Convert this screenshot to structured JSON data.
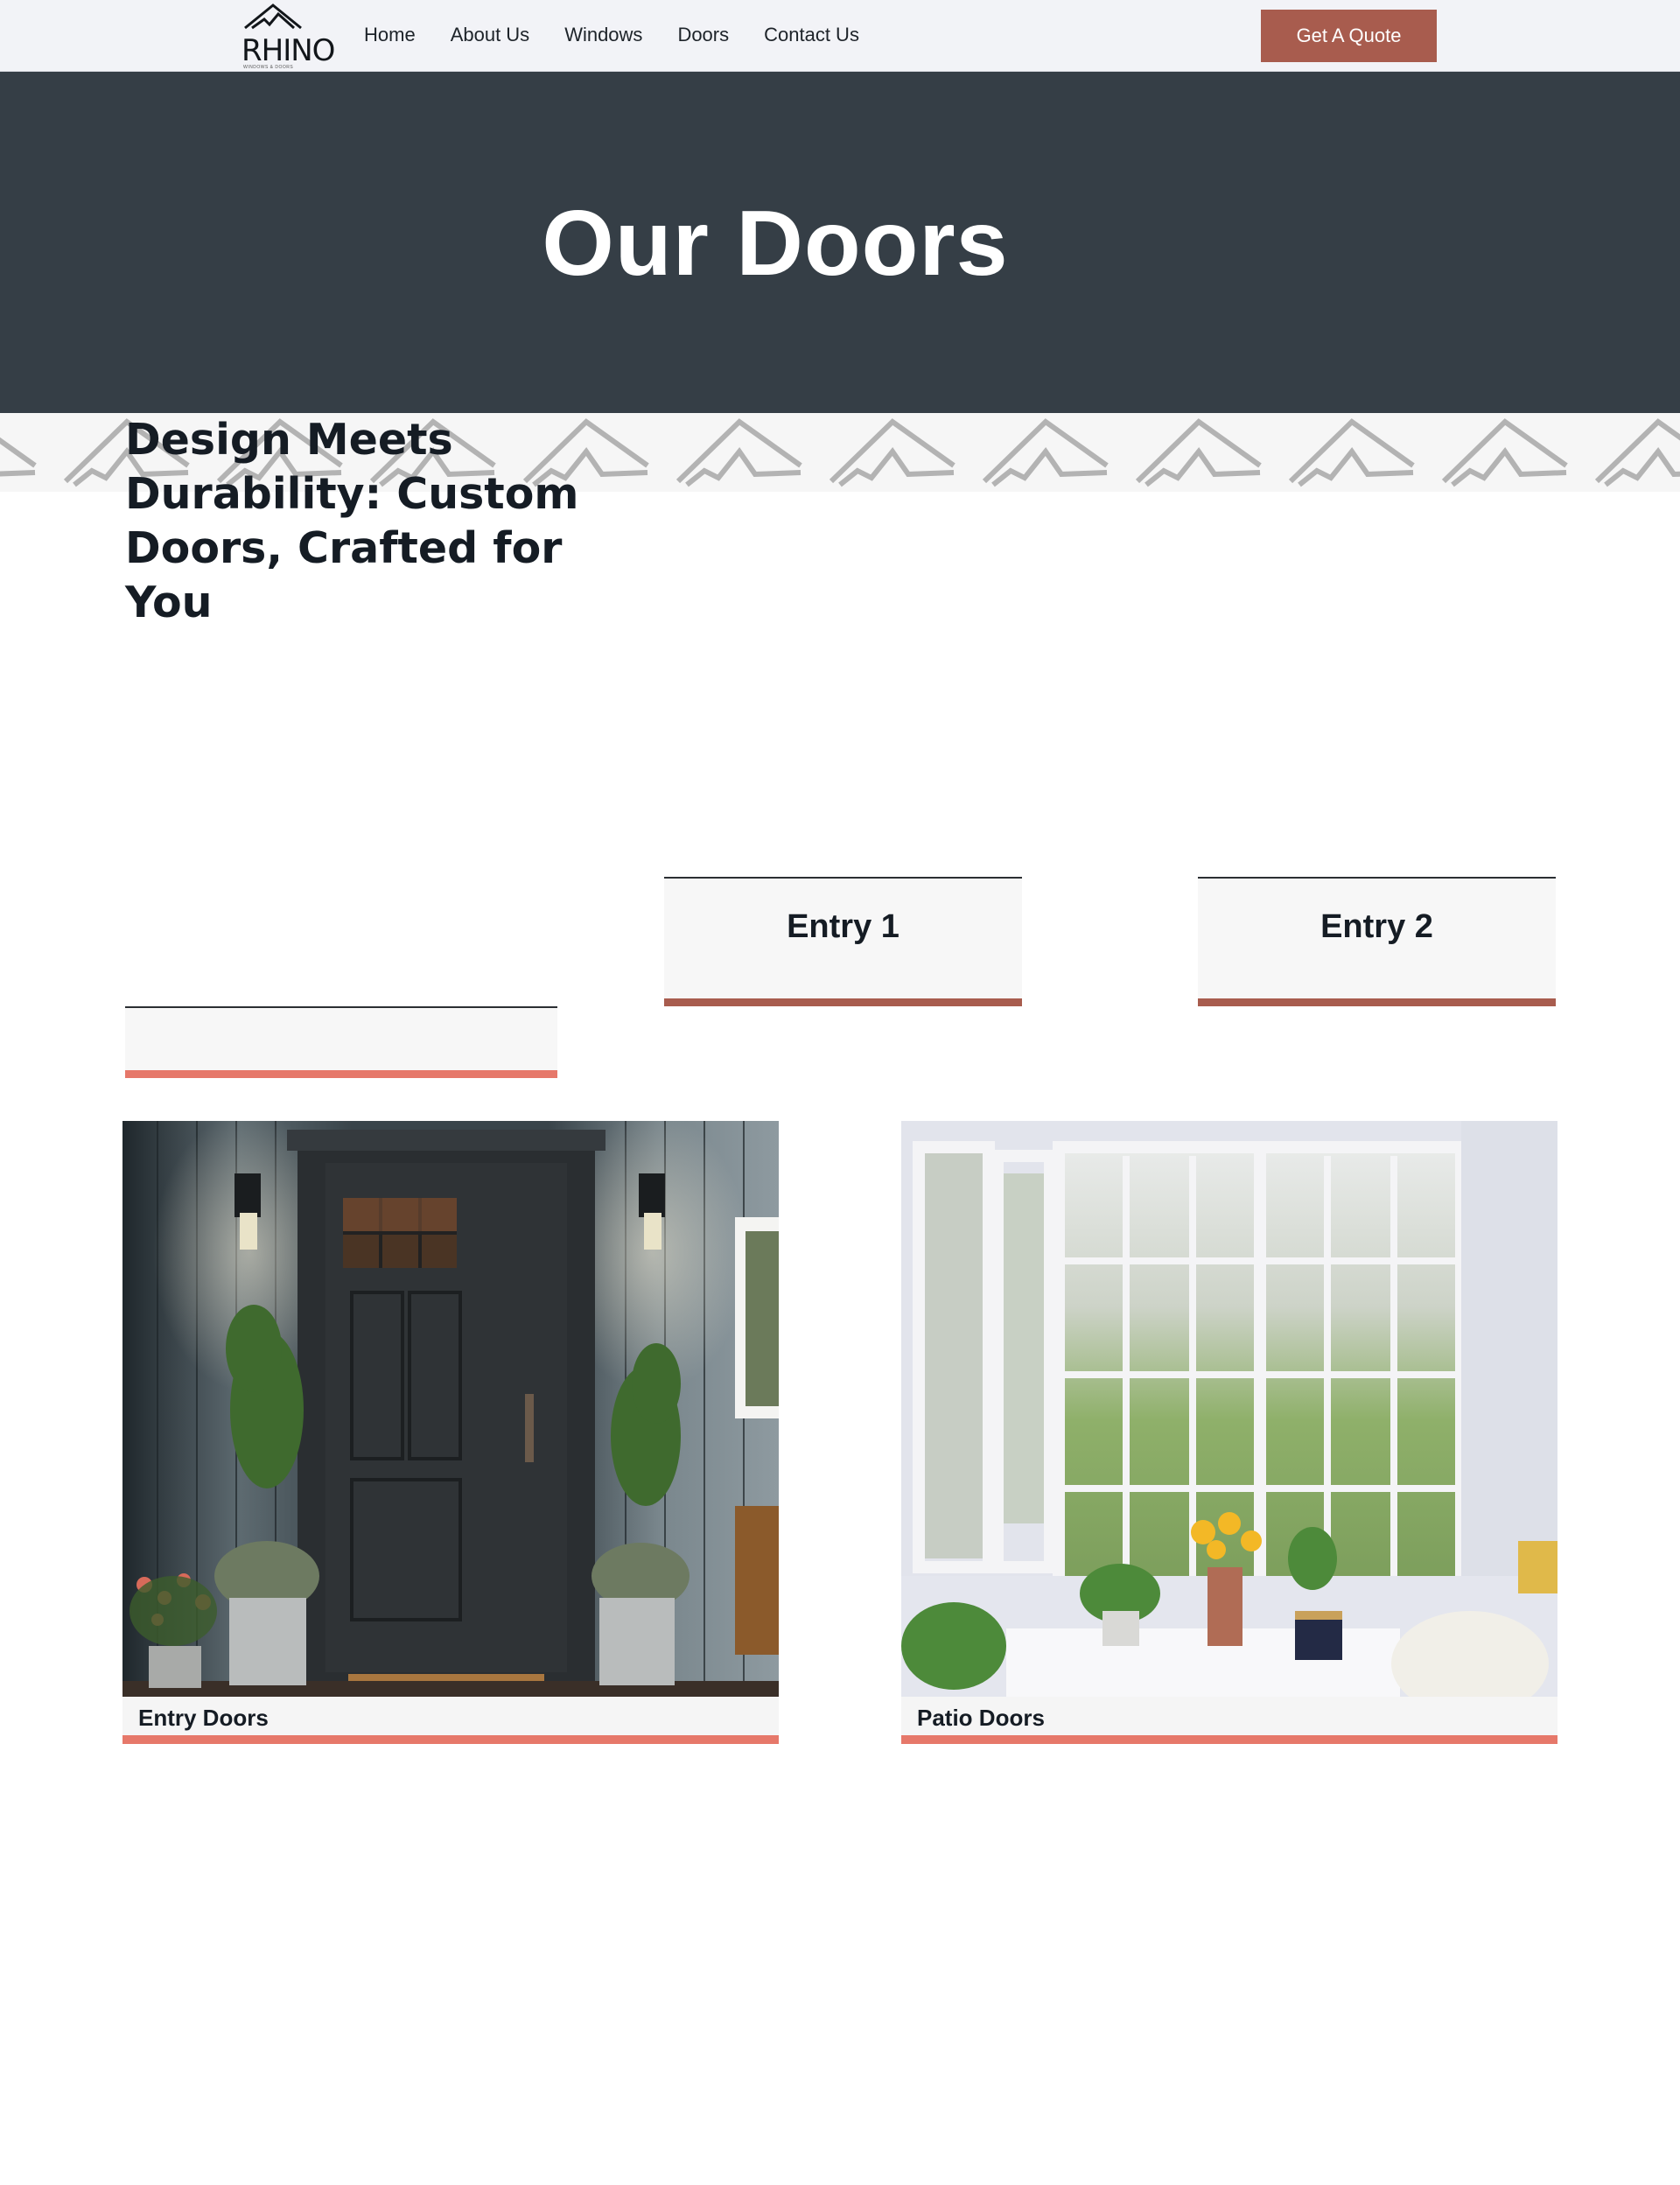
{
  "header": {
    "logo_text": "RHINO",
    "logo_subtext": "WINDOWS & DOORS",
    "nav": [
      "Home",
      "About Us",
      "Windows",
      "Doors",
      "Contact Us"
    ],
    "cta_label": "Get A Quote"
  },
  "hero": {
    "title": "Our Doors"
  },
  "section": {
    "heading": "Design Meets Durability: Custom Doors, Crafted for You"
  },
  "cards": {
    "entry_1": "Entry 1",
    "entry_2": "Entry 2"
  },
  "gallery": [
    {
      "caption": "Entry Doors"
    },
    {
      "caption": "Patio Doors"
    }
  ],
  "colors": {
    "header_bg": "#f2f3f7",
    "hero_bg": "#353e46",
    "accent_brand": "#a85c4e",
    "accent_coral": "#e6786a",
    "card_bg": "#f7f7f7"
  }
}
